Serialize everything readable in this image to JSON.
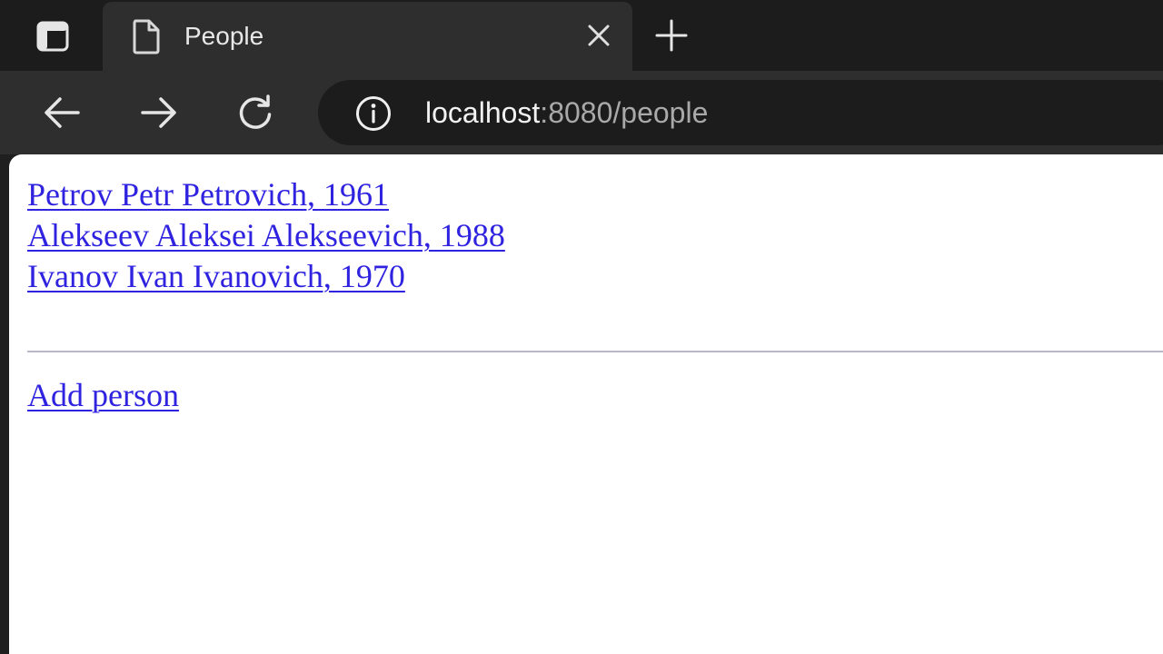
{
  "browser": {
    "tab": {
      "title": "People"
    },
    "address_bar": {
      "host": "localhost",
      "rest": ":8080/people"
    }
  },
  "page": {
    "people": [
      {
        "label": "Petrov Petr Petrovich, 1961"
      },
      {
        "label": "Alekseev Aleksei Alekseevich, 1988"
      },
      {
        "label": "Ivanov Ivan Ivanovich, 1970"
      }
    ],
    "add_person_label": "Add person"
  }
}
